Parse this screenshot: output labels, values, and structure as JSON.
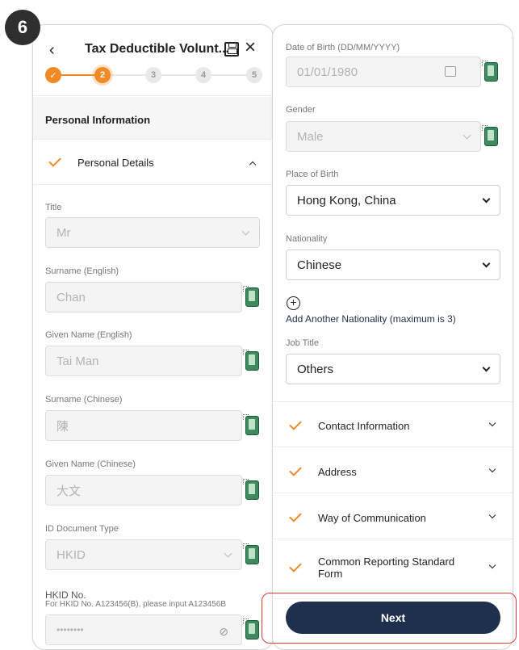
{
  "step_badge": "6",
  "header": {
    "back_icon": "chevron-left-icon",
    "title": "Tax Deductible Volunt...",
    "save_icon": "save-icon",
    "close_icon": "close-icon"
  },
  "stepper": {
    "current": 2,
    "steps": [
      "✓",
      "2",
      "3",
      "4",
      "5"
    ]
  },
  "left": {
    "section_title": "Personal Information",
    "accordion_label": "Personal Details",
    "fields": {
      "title_label": "Title",
      "title_value": "Mr",
      "surname_en_label": "Surname (English)",
      "surname_en_value": "Chan",
      "given_en_label": "Given Name (English)",
      "given_en_value": "Tai Man",
      "surname_zh_label": "Surname (Chinese)",
      "surname_zh_value": "陳",
      "given_zh_label": "Given Name (Chinese)",
      "given_zh_value": "大文",
      "id_type_label": "ID Document Type",
      "id_type_value": "HKID",
      "hkid_label": "HKID No.",
      "hkid_hint": "For HKID No. A123456(B), please input A123456B",
      "hkid_value": "••••••••"
    }
  },
  "right": {
    "dob_label": "Date of Birth (DD/MM/YYYY)",
    "dob_value": "01/01/1980",
    "gender_label": "Gender",
    "gender_value": "Male",
    "pob_label": "Place of Birth",
    "pob_value": "Hong Kong, China",
    "nationality_label": "Nationality",
    "nationality_value": "Chinese",
    "add_nationality": "Add Another Nationality (maximum is 3)",
    "job_label": "Job Title",
    "job_value": "Others",
    "sections": {
      "contact": "Contact Information",
      "address": "Address",
      "communication": "Way of Communication",
      "crs": "Common Reporting Standard Form"
    },
    "next_label": "Next"
  },
  "colors": {
    "accent": "#f08a24",
    "primary": "#1f2f4e",
    "highlight": "#e03a3a"
  }
}
